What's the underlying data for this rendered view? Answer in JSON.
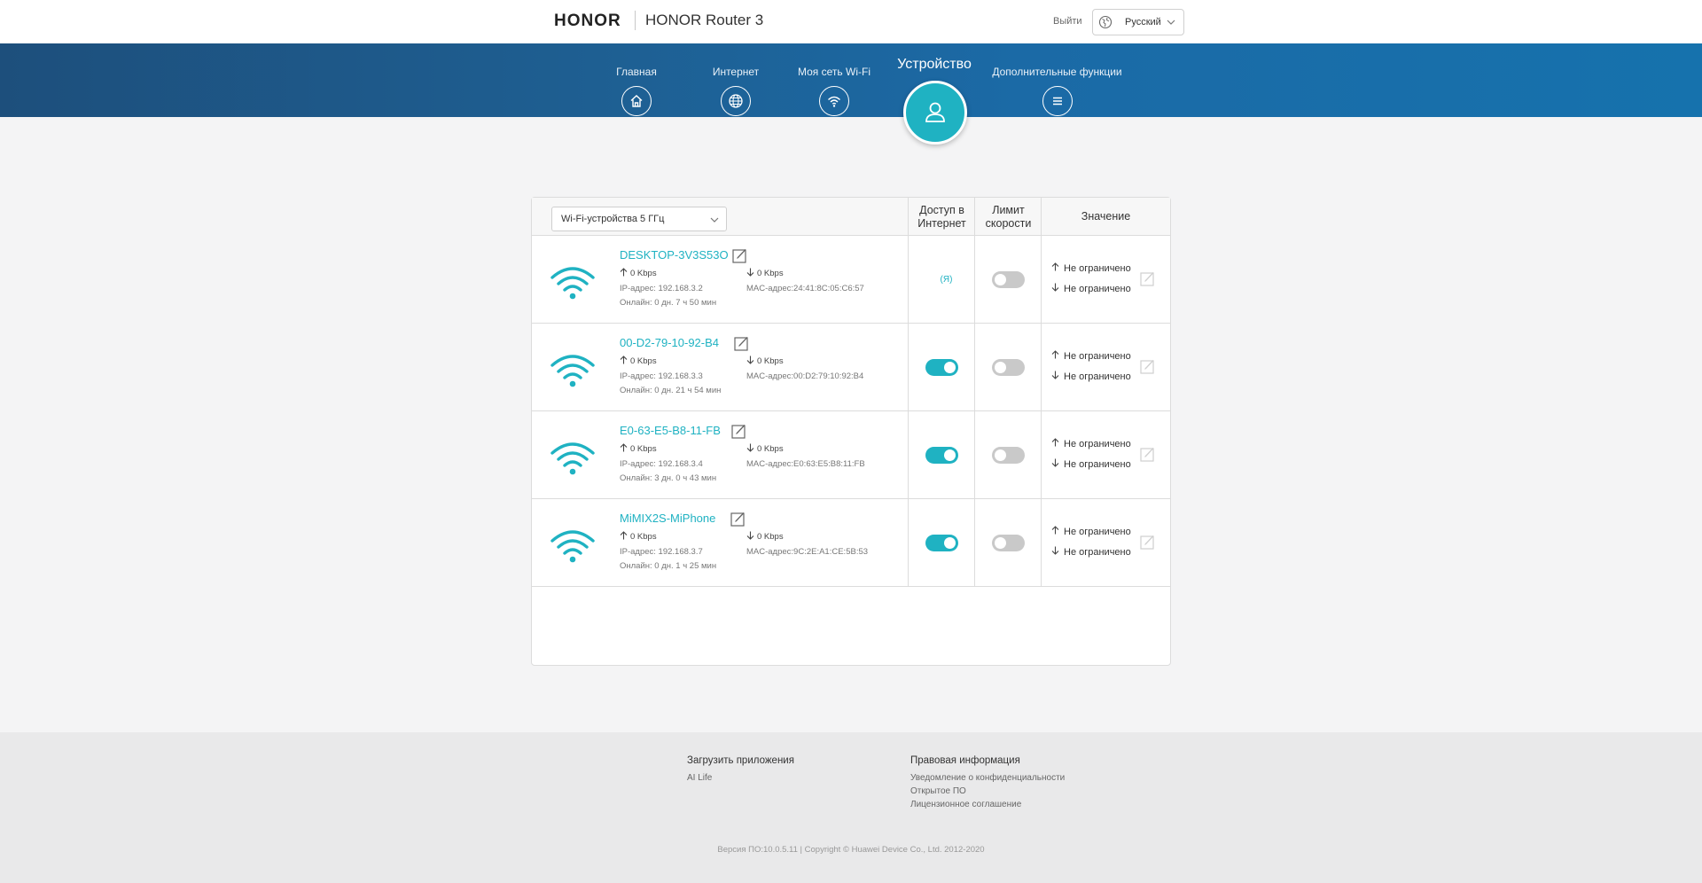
{
  "header": {
    "brand": "HONOR",
    "product": "HONOR Router 3",
    "logout": "Выйти",
    "language": "Русский"
  },
  "nav": {
    "items": [
      {
        "label": "Главная",
        "icon": "home-icon"
      },
      {
        "label": "Интернет",
        "icon": "globe-icon"
      },
      {
        "label": "Моя сеть Wi-Fi",
        "icon": "wifi-icon"
      },
      {
        "label": "Устройство",
        "icon": "user-icon"
      },
      {
        "label": "Дополнительные функции",
        "icon": "menu-icon"
      }
    ],
    "active": "Устройство"
  },
  "table": {
    "filter": "Wi-Fi-устройства 5 ГГц",
    "col_access": "Доступ в Интернет",
    "col_speed": "Лимит скорости",
    "col_value": "Значение",
    "devices": [
      {
        "name": "DESKTOP-3V3S53O",
        "up": "0 Kbps",
        "down": "0 Kbps",
        "ip": "IP-адрес: 192.168.3.2",
        "mac": "MAC-адрес:24:41:8C:05:C6:57",
        "online": "Онлайн: 0 дн. 7 ч 50 мин",
        "access_label": "(Я)",
        "access": null,
        "speed_limit": false,
        "up_limit": "Не ограничено",
        "down_limit": "Не ограничено"
      },
      {
        "name": "00-D2-79-10-92-B4",
        "up": "0 Kbps",
        "down": "0 Kbps",
        "ip": "IP-адрес: 192.168.3.3",
        "mac": "MAC-адрес:00:D2:79:10:92:B4",
        "online": "Онлайн: 0 дн. 21 ч 54 мин",
        "access": true,
        "speed_limit": false,
        "up_limit": "Не ограничено",
        "down_limit": "Не ограничено"
      },
      {
        "name": "E0-63-E5-B8-11-FB",
        "up": "0 Kbps",
        "down": "0 Kbps",
        "ip": "IP-адрес: 192.168.3.4",
        "mac": "MAC-адрес:E0:63:E5:B8:11:FB",
        "online": "Онлайн: 3 дн. 0 ч 43 мин",
        "access": true,
        "speed_limit": false,
        "up_limit": "Не ограничено",
        "down_limit": "Не ограничено"
      },
      {
        "name": "MiMIX2S-MiPhone",
        "up": "0 Kbps",
        "down": "0 Kbps",
        "ip": "IP-адрес: 192.168.3.7",
        "mac": "MAC-адрес:9C:2E:A1:CE:5B:53",
        "online": "Онлайн: 0 дн. 1 ч 25 мин",
        "access": true,
        "speed_limit": false,
        "up_limit": "Не ограничено",
        "down_limit": "Не ограничено"
      }
    ]
  },
  "footer": {
    "apps_heading": "Загрузить приложения",
    "apps_link": "AI Life",
    "legal_heading": "Правовая информация",
    "legal_links": [
      "Уведомление о конфиденциальности",
      "Открытое ПО",
      "Лицензионное соглашение"
    ],
    "copyright": "Версия ПО:10.0.5.11 |  Copyright © Huawei Device Co., Ltd. 2012-2020"
  },
  "colors": {
    "accent": "#1fb2c2",
    "nav_band": "#1b6aa6",
    "toggle_off": "#c9c9c9"
  }
}
